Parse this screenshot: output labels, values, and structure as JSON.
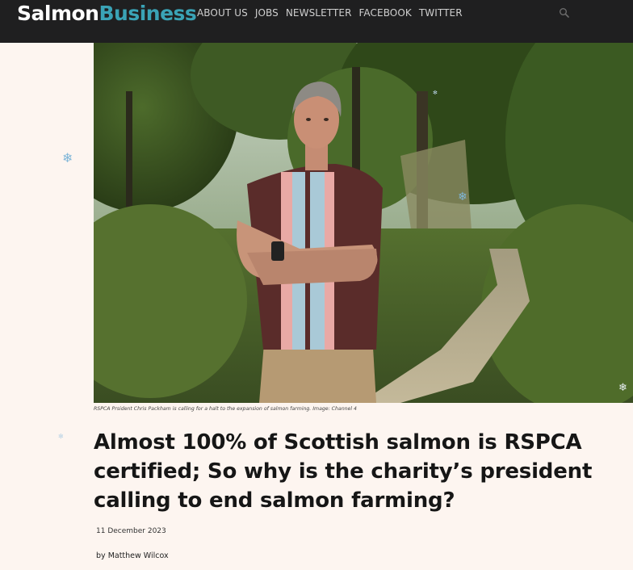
{
  "header": {
    "logo_part1": "Salmon",
    "logo_part2": "Business",
    "nav": [
      "ABOUT US",
      "JOBS",
      "NEWSLETTER",
      "FACEBOOK",
      "TWITTER"
    ],
    "search_icon": "search-icon"
  },
  "article": {
    "image_caption": "RSPCA Prsident Chris Packham is calling for a halt to the expansion of salmon farming. Image: Channel 4",
    "headline": "Almost 100% of Scottish salmon is RSPCA certified; So why is the charity’s president calling to end salmon farming?",
    "date": "11 December 2023",
    "byline_prefix": "by ",
    "author": "Matthew Wilcox"
  },
  "colors": {
    "topbar": "#1f1f20",
    "logo_accent": "#3aa3b6",
    "page_bg": "#fdf5f0",
    "headline": "#161616"
  },
  "decorations": {
    "snowflake_icon": "snowflake-icon"
  }
}
